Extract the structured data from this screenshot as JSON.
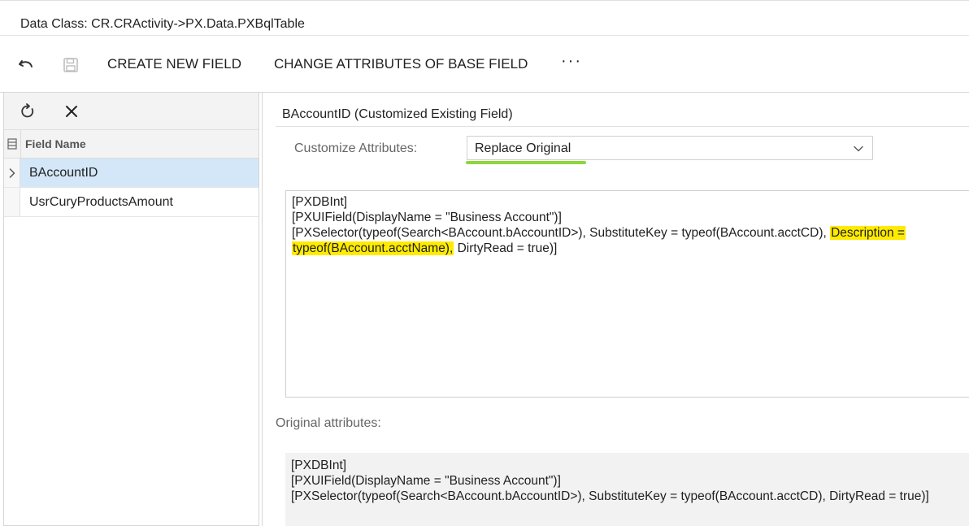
{
  "header": {
    "title": "Data Class: CR.CRActivity->PX.Data.PXBqlTable"
  },
  "toolbar": {
    "undo_icon": "undo-icon",
    "save_icon": "save-icon",
    "create_new_field": "CREATE NEW FIELD",
    "change_attributes": "CHANGE ATTRIBUTES OF BASE FIELD",
    "more": "···"
  },
  "left_panel": {
    "refresh_icon": "refresh-icon",
    "close_icon": "close-icon",
    "column_header": "Field Name",
    "rows": [
      {
        "name": "BAccountID",
        "selected": true
      },
      {
        "name": "UsrCuryProductsAmount",
        "selected": false
      }
    ]
  },
  "right_panel": {
    "section_title": "BAccountID (Customized Existing Field)",
    "customize_label": "Customize Attributes:",
    "customize_value": "Replace Original",
    "editor": {
      "line1": "[PXDBInt]",
      "line2": "[PXUIField(DisplayName = \"Business Account\")]",
      "line3_pre": "[PXSelector(typeof(Search<BAccount.bAccountID>), SubstituteKey = typeof(BAccount.acctCD), ",
      "line3_hl": "Description = ",
      "line4_hl": "typeof(BAccount.acctName),",
      "line4_post": " DirtyRead = true)]"
    },
    "original_label": "Original attributes:",
    "original": {
      "line1": "[PXDBInt]",
      "line2": "[PXUIField(DisplayName = \"Business Account\")]",
      "line3": "[PXSelector(typeof(Search<BAccount.bAccountID>), SubstituteKey = typeof(BAccount.acctCD), DirtyRead = true)]"
    }
  },
  "colors": {
    "highlight": "#ffeb00",
    "selected_row": "#d3e7f8",
    "accent_underline": "#8dd63c"
  }
}
